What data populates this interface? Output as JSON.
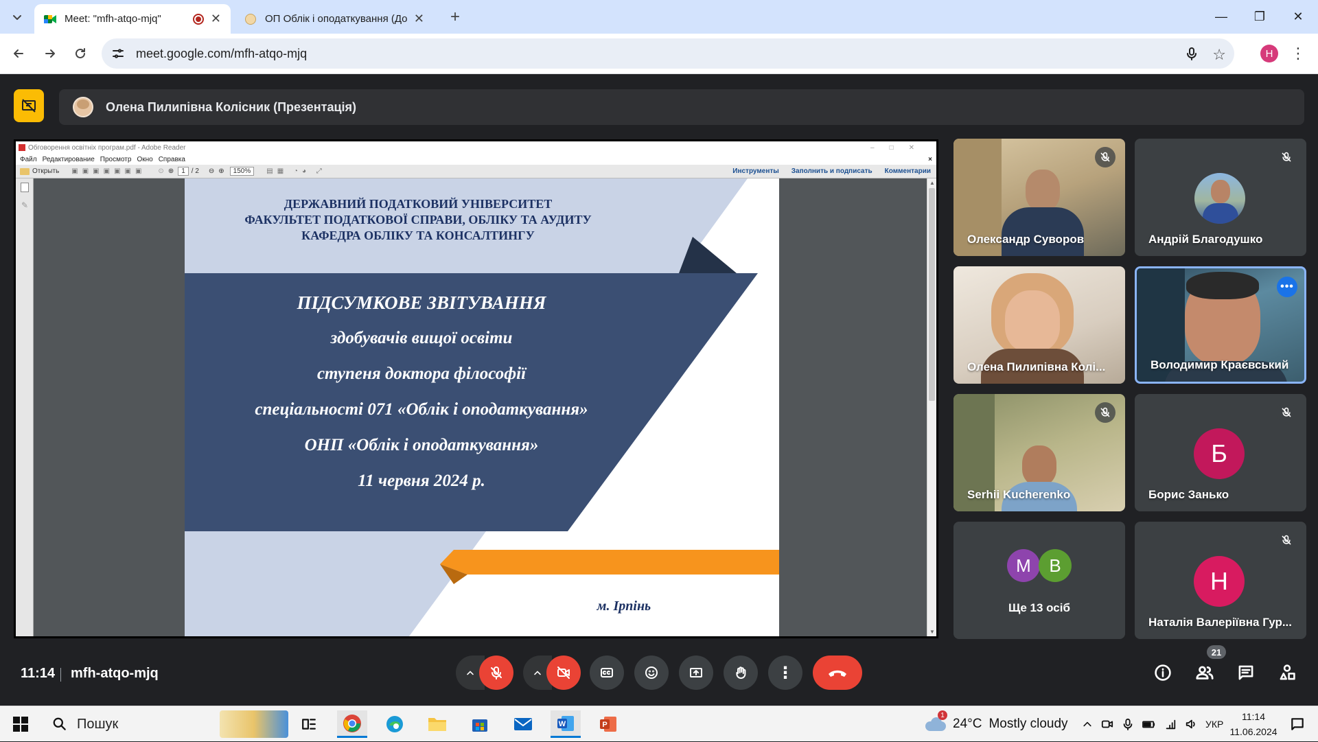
{
  "browser": {
    "tabs": [
      {
        "title": "Meet: \"mfh-atqo-mjq\"",
        "active": true
      },
      {
        "title": "ОП Облік і оподаткування (До",
        "active": false
      }
    ],
    "url": "meet.google.com/mfh-atqo-mjq",
    "profile_initial": "H",
    "profile_color": "#d63a7a"
  },
  "meet": {
    "presenter_banner": "Олена Пилипівна Колісник (Презентація)",
    "meeting_time": "11:14",
    "meeting_code": "mfh-atqo-mjq",
    "participants_count": "21",
    "end_call_color": "#ea4335"
  },
  "reader": {
    "title": "Обговорення освітніх програм.pdf - Adobe Reader",
    "menu": [
      "Файл",
      "Редактирование",
      "Просмотр",
      "Окно",
      "Справка"
    ],
    "open_label": "Открыть",
    "page_current": "1",
    "page_total": "/ 2",
    "zoom": "150%",
    "right_tools": [
      "Инструменты",
      "Заполнить и подписать",
      "Комментарии"
    ]
  },
  "slide": {
    "header_lines": [
      "ДЕРЖАВНИЙ ПОДАТКОВИЙ УНІВЕРСИТЕТ",
      "ФАКУЛЬТЕТ ПОДАТКОВОЇ СПРАВИ, ОБЛІКУ ТА АУДИТУ",
      "КАФЕДРА ОБЛІКУ ТА КОНСАЛТИНГУ"
    ],
    "body_lines": [
      "ПІДСУМКОВЕ ЗВІТУВАННЯ",
      "здобувачів вищої освіти",
      "ступеня доктора філософії",
      "спеціальності 071 «Облік і оподаткування»",
      "ОНП «Облік і оподаткування»",
      "11 червня 2024 р."
    ],
    "footer": "м. Ірпінь",
    "colors": {
      "navy": "#3b4f73",
      "light": "#c9d3e6",
      "dark": "#243248",
      "orange": "#f7941d",
      "header_text": "#1c3163"
    }
  },
  "participants": [
    {
      "name": "Олександр Суворов",
      "muted": true,
      "type": "video"
    },
    {
      "name": "Андрій Благодушко",
      "muted": true,
      "type": "photo"
    },
    {
      "name": "Олена Пилипівна Колі...",
      "muted": false,
      "type": "video"
    },
    {
      "name": "Володимир Краєвський",
      "muted": false,
      "type": "video",
      "speaking": true
    },
    {
      "name": "Serhii Kucherenko",
      "muted": true,
      "type": "video"
    },
    {
      "name": "Борис Занько",
      "muted": true,
      "type": "avatar",
      "initial": "Б",
      "color": "#c2185b"
    },
    {
      "name": "Ще 13 осіб",
      "type": "more",
      "initials": [
        "M",
        "B"
      ],
      "colors": [
        "#8e44ad",
        "#5c9e31"
      ]
    },
    {
      "name": "Наталія Валеріївна Гур...",
      "muted": true,
      "type": "avatar",
      "initial": "Н",
      "color": "#d81b60"
    }
  ],
  "taskbar": {
    "search_label": "Пошук",
    "weather_temp": "24°C",
    "weather_text": "Mostly cloudy",
    "weather_badge": "1",
    "language": "УКР",
    "clock_time": "11:14",
    "clock_date": "11.06.2024"
  }
}
